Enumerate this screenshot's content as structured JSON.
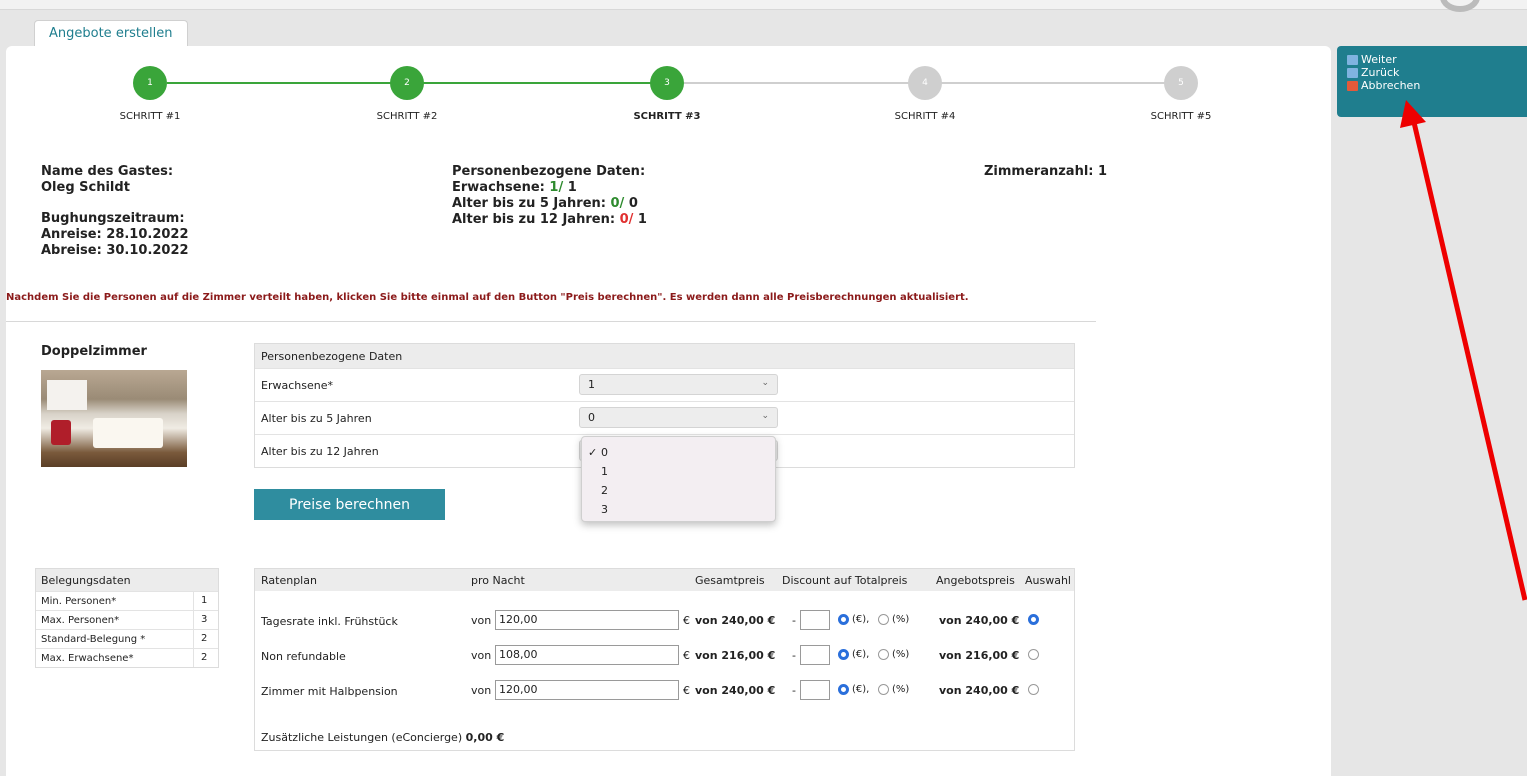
{
  "tab": {
    "label": "Angebote erstellen"
  },
  "sidebar": {
    "items": [
      {
        "label": "Weiter",
        "icon": "forward-icon",
        "color": "#5fa0d8"
      },
      {
        "label": "Zurück",
        "icon": "back-icon",
        "color": "#5fa0d8"
      },
      {
        "label": "Abbrechen",
        "icon": "cancel-icon",
        "color": "#e04040"
      }
    ]
  },
  "steps": [
    {
      "number": "1",
      "label": "SCHRITT #1",
      "state": "done"
    },
    {
      "number": "2",
      "label": "SCHRITT #2",
      "state": "done"
    },
    {
      "number": "3",
      "label": "SCHRITT #3",
      "state": "active"
    },
    {
      "number": "4",
      "label": "SCHRITT #4",
      "state": "pending"
    },
    {
      "number": "5",
      "label": "SCHRITT #5",
      "state": "pending"
    }
  ],
  "colors": {
    "accent": "#1f7e8e",
    "step_done": "#3aa53a",
    "step_pending": "#cfcfcf",
    "button": "#2f8d9f",
    "notice": "#8b1a1a"
  },
  "guest": {
    "name_label": "Name des Gastes:",
    "name": "Oleg Schildt",
    "period_label": "Bughungszeitraum:",
    "arrival": "Anreise: 28.10.2022",
    "departure": "Abreise: 30.10.2022"
  },
  "persons": {
    "title": "Personenbezogene Daten:",
    "adults_label": "Erwachsene:",
    "adults_value": "1/",
    "adults_total": "1",
    "age5_label": "Alter bis zu 5 Jahren:",
    "age5_value": "0/",
    "age5_total": "0",
    "age12_label": "Alter bis zu 12 Jahren:",
    "age12_value": "0/",
    "age12_total": "1"
  },
  "rooms_count": "Zimmeranzahl: 1",
  "notice": "Nachdem Sie die Personen auf die Zimmer verteilt haben, klicken Sie bitte einmal auf den Button \"Preis berechnen\". Es werden dann alle Preisberechnungen aktualisiert.",
  "room": {
    "title": "Doppelzimmer",
    "table_header": "Personenbezogene Daten",
    "rows": [
      {
        "label": "Erwachsene*",
        "value": "1"
      },
      {
        "label": "Alter bis zu 5 Jahren",
        "value": "0"
      },
      {
        "label": "Alter bis zu 12 Jahren",
        "value": "0"
      }
    ],
    "dropdown_options": [
      "0",
      "1",
      "2",
      "3"
    ],
    "dropdown_selected": "0",
    "calc_button": "Preise berechnen"
  },
  "occupancy": {
    "title": "Belegungsdaten",
    "rows": [
      {
        "label": "Min. Personen*",
        "value": "1"
      },
      {
        "label": "Max. Personen*",
        "value": "3"
      },
      {
        "label": "Standard-Belegung *",
        "value": "2"
      },
      {
        "label": "Max. Erwachsene*",
        "value": "2"
      }
    ]
  },
  "rates": {
    "headers": {
      "plan": "Ratenplan",
      "per_night": "pro Nacht",
      "total": "Gesamtpreis",
      "discount": "Discount auf Totalpreis",
      "offer": "Angebotspreis",
      "select": "Auswahl"
    },
    "rows": [
      {
        "name": "Tagesrate inkl. Frühstück",
        "von": "von",
        "price": "120,00",
        "eur": "€",
        "total": "von 240,00 €",
        "dash": "-",
        "opt_eur": "(€),",
        "opt_pct": "(%)",
        "offer": "von 240,00 €",
        "selected": true
      },
      {
        "name": "Non refundable",
        "von": "von",
        "price": "108,00",
        "eur": "€",
        "total": "von 216,00 €",
        "dash": "-",
        "opt_eur": "(€),",
        "opt_pct": "(%)",
        "offer": "von 216,00 €",
        "selected": false
      },
      {
        "name": "Zimmer mit Halbpension",
        "von": "von",
        "price": "120,00",
        "eur": "€",
        "total": "von 240,00 €",
        "dash": "-",
        "opt_eur": "(€),",
        "opt_pct": "(%)",
        "offer": "von 240,00 €",
        "selected": false
      }
    ],
    "extra_label": "Zusätzliche Leistungen (eConcierge)",
    "extra_value": "0,00 €"
  }
}
